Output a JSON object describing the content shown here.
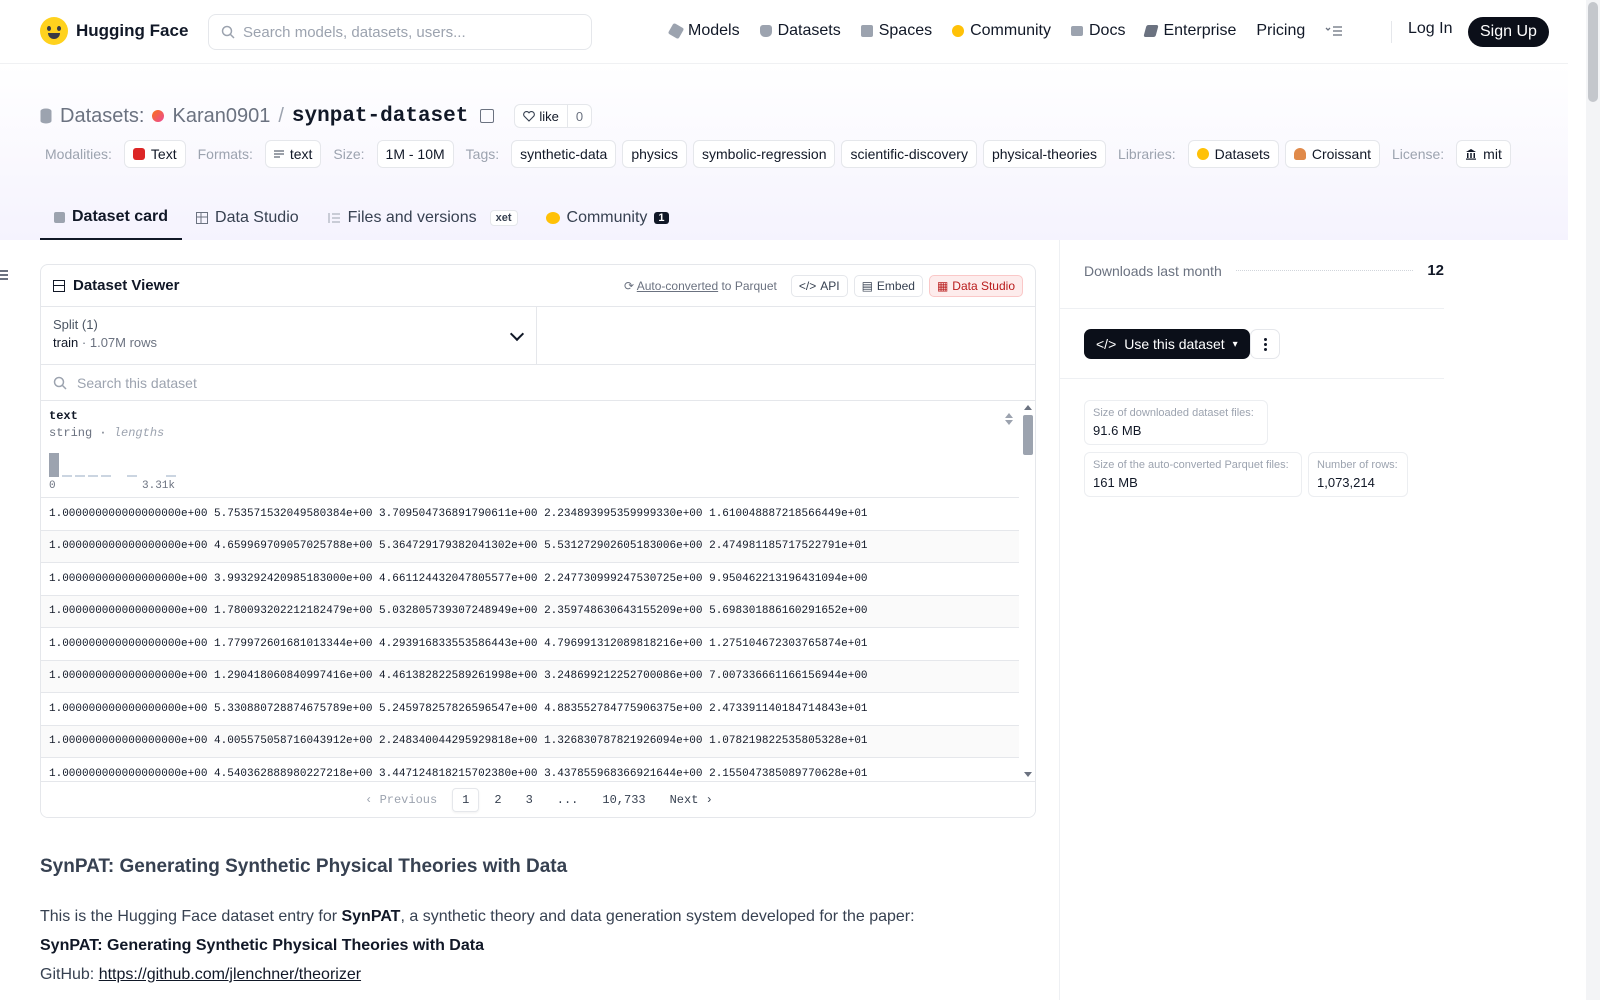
{
  "brand": {
    "name": "Hugging Face"
  },
  "search": {
    "placeholder": "Search models, datasets, users..."
  },
  "nav": {
    "items": [
      {
        "label": "Models",
        "icon": "cube-icon",
        "color": "#9ca3af"
      },
      {
        "label": "Datasets",
        "icon": "database-icon",
        "color": "#9ca3af"
      },
      {
        "label": "Spaces",
        "icon": "grid-icon",
        "color": "#9ca3af"
      },
      {
        "label": "Community",
        "icon": "hugging-face-icon",
        "color": "#ffc107"
      },
      {
        "label": "Docs",
        "icon": "book-icon",
        "color": "#9ca3af"
      },
      {
        "label": "Enterprise",
        "icon": "enterprise-icon",
        "color": "#6b7280"
      },
      {
        "label": "Pricing",
        "icon": "",
        "color": ""
      }
    ],
    "login": "Log In",
    "signup": "Sign Up"
  },
  "dataset": {
    "section": "Datasets:",
    "owner": "Karan0901",
    "name": "synpat-dataset",
    "like_label": "like",
    "like_count": "0"
  },
  "meta": {
    "modalities_label": "Modalities:",
    "modalities": [
      "Text"
    ],
    "formats_label": "Formats:",
    "formats": [
      "text"
    ],
    "size_label": "Size:",
    "size": "1M - 10M",
    "tags_label": "Tags:",
    "tags": [
      "synthetic-data",
      "physics",
      "symbolic-regression",
      "scientific-discovery",
      "physical-theories"
    ],
    "libraries_label": "Libraries:",
    "libraries": [
      "Datasets",
      "Croissant"
    ],
    "license_label": "License:",
    "license": "mit"
  },
  "tabs": {
    "card": "Dataset card",
    "studio": "Data Studio",
    "files": "Files and versions",
    "xet": "xet",
    "community": "Community",
    "community_count": "1"
  },
  "viewer": {
    "title": "Dataset Viewer",
    "auto_converted": "Auto-converted",
    "to_parquet": " to Parquet",
    "api": "API",
    "embed": "Embed",
    "studio": "Data Studio",
    "split_label": "Split (1)",
    "split_name": "train",
    "split_rows": "1.07M rows",
    "search_placeholder": "Search this dataset",
    "column": {
      "name": "text",
      "type": "string",
      "stat": "lengths",
      "hist_min": "0",
      "hist_max": "3.31k"
    },
    "histogram": [
      1.0,
      0.09,
      0.06,
      0.06,
      0.04,
      0.0,
      0.03,
      0.0,
      0.0,
      0.02
    ],
    "rows": [
      "1.000000000000000000e+00 5.753571532049580384e+00 3.709504736891790611e+00 2.234893995359999330e+00 1.610048887218566449e+01",
      "1.000000000000000000e+00 4.659969709057025788e+00 5.364729179382041302e+00 5.531272902605183006e+00 2.474981185717522791e+01",
      "1.000000000000000000e+00 3.993292420985183000e+00 4.661124432047805577e+00 2.247730999247530725e+00 9.950462213196431094e+00",
      "1.000000000000000000e+00 1.780093202212182479e+00 5.032805739307248949e+00 2.359748630643155209e+00 5.698301886160291652e+00",
      "1.000000000000000000e+00 1.779972601681013344e+00 4.293916833553586443e+00 4.796991312089818216e+00 1.275104672303765874e+01",
      "1.000000000000000000e+00 1.290418060840997416e+00 4.461382822589261998e+00 3.248699212252700086e+00 7.007336661166156944e+00",
      "1.000000000000000000e+00 5.330880728874675789e+00 5.245978257826596547e+00 4.883552784775906375e+00 2.473391140184714843e+01",
      "1.000000000000000000e+00 4.005575058716043912e+00 2.248340044295929818e+00 1.326830787821926094e+00 1.078219822535805328e+01",
      "1.000000000000000000e+00 4.540362888980227218e+00 3.447124818215702380e+00 3.437855968366921644e+00 2.155047385089770628e+01"
    ],
    "pager": {
      "prev": "Previous",
      "pages": [
        "1",
        "2",
        "3",
        "...",
        "10,733"
      ],
      "next": "Next"
    }
  },
  "sidebar": {
    "downloads_label": "Downloads last month",
    "downloads_value": "12",
    "use_button": "Use this dataset",
    "downloaded_size_label": "Size of downloaded dataset files:",
    "downloaded_size": "91.6 MB",
    "parquet_size_label": "Size of the auto-converted Parquet files:",
    "parquet_size": "161 MB",
    "rows_label": "Number of rows:",
    "rows_value": "1,073,214"
  },
  "readme": {
    "heading": "SynPAT: Generating Synthetic Physical Theories with Data",
    "intro_pre": "This is the Hugging Face dataset entry for ",
    "intro_bold": "SynPAT",
    "intro_post": ", a synthetic theory and data generation system developed for the paper:",
    "paper_title": "SynPAT: Generating Synthetic Physical Theories with Data",
    "github_label": "GitHub: ",
    "github_link": "https://github.com/jlenchner/theorizer"
  }
}
